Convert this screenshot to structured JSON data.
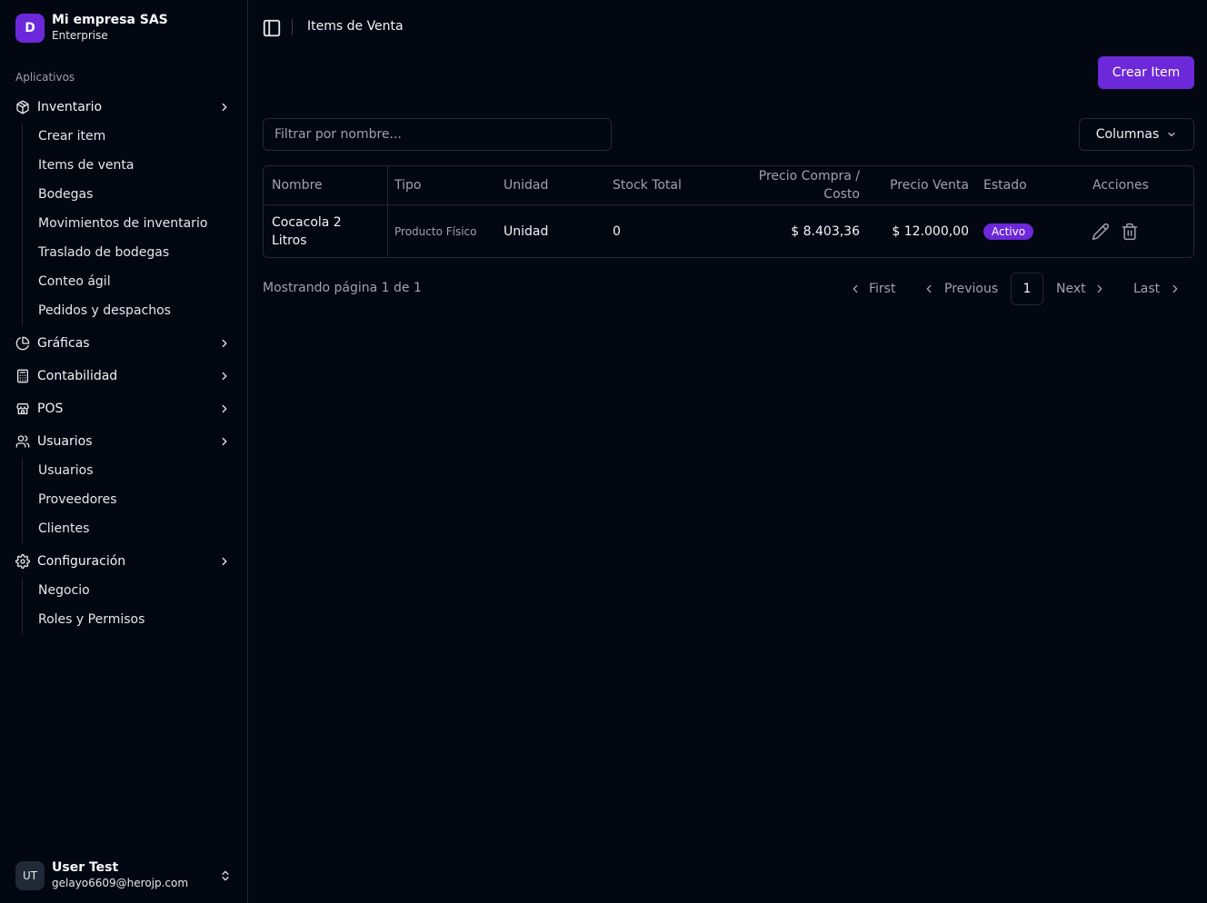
{
  "brand": {
    "initial": "D",
    "name": "Mi empresa SAS",
    "plan": "Enterprise"
  },
  "sidebar": {
    "group_label": "Aplicativos",
    "inventario": {
      "label": "Inventario",
      "icon": "package-icon",
      "items": [
        "Crear item",
        "Items de venta",
        "Bodegas",
        "Movimientos de inventario",
        "Traslado de bodegas",
        "Conteo ágil",
        "Pedidos y despachos"
      ]
    },
    "graficas": {
      "label": "Gráficas",
      "icon": "pie-chart-icon"
    },
    "contabilidad": {
      "label": "Contabilidad",
      "icon": "calculator-icon"
    },
    "pos": {
      "label": "POS",
      "icon": "store-icon"
    },
    "usuarios": {
      "label": "Usuarios",
      "icon": "users-icon",
      "items": [
        "Usuarios",
        "Proveedores",
        "Clientes"
      ]
    },
    "configuracion": {
      "label": "Configuración",
      "icon": "gear-icon",
      "items": [
        "Negocio",
        "Roles y Permisos"
      ]
    }
  },
  "user": {
    "initials": "UT",
    "name": "User Test",
    "email": "gelayo6609@herojp.com"
  },
  "header": {
    "breadcrumb": "Items de Venta"
  },
  "toolbar": {
    "create_label": "Crear Item",
    "filter_placeholder": "Filtrar por nombre...",
    "columns_label": "Columnas"
  },
  "table": {
    "headers": {
      "nombre": "Nombre",
      "tipo": "Tipo",
      "unidad": "Unidad",
      "stock": "Stock Total",
      "compra_line1": "Precio Compra /",
      "compra_line2": "Costo",
      "venta": "Precio Venta",
      "estado": "Estado",
      "acciones": "Acciones"
    },
    "rows": [
      {
        "nombre_line1": "Cocacola 2",
        "nombre_line2": "Litros",
        "tipo": "Producto Físico",
        "unidad": "Unidad",
        "stock": "0",
        "compra": "$ 8.403,36",
        "venta": "$ 12.000,00",
        "estado": "Activo"
      }
    ]
  },
  "pagination": {
    "info": "Mostrando página 1 de 1",
    "first": "First",
    "previous": "Previous",
    "current": "1",
    "next": "Next",
    "last": "Last"
  },
  "colors": {
    "accent": "#6d28d9",
    "background": "#030712",
    "border": "#1f2937"
  }
}
